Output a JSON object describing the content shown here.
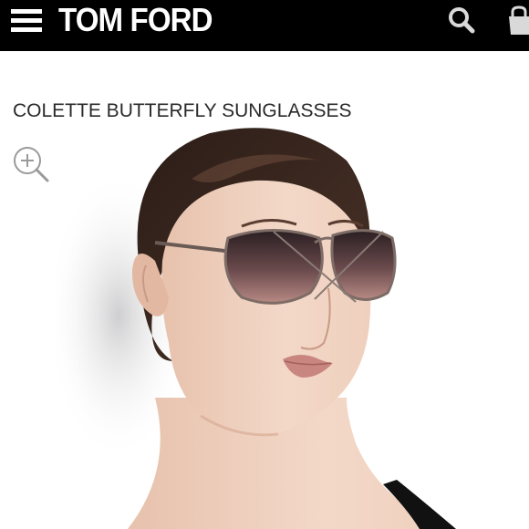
{
  "header": {
    "brand": "TOM FORD",
    "menu_icon": "hamburger-menu-icon",
    "search_icon": "search-icon",
    "bag_icon": "shopping-bag-icon",
    "background": "#000000"
  },
  "product": {
    "title": "COLETTE BUTTERFLY SUNGLASSES",
    "zoom_icon": "zoom-in-icon",
    "image_alt": "Model wearing butterfly sunglasses"
  }
}
